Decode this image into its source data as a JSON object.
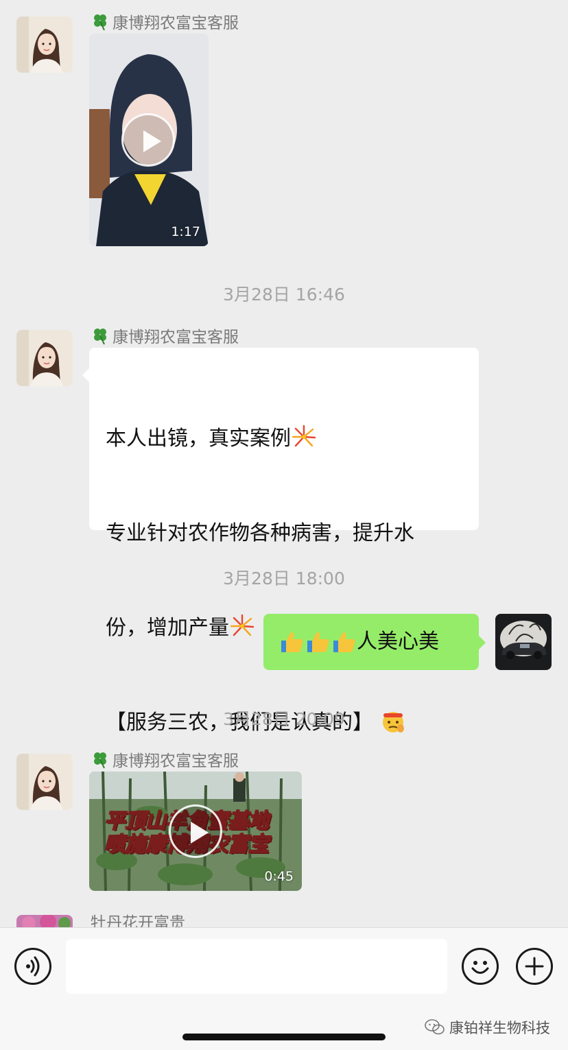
{
  "colors": {
    "background": "#ededed",
    "incoming_bubble": "#ffffff",
    "outgoing_bubble": "#95ec69",
    "timestamp": "#a4a4a4"
  },
  "messages": [
    {
      "sender": "康博翔农富宝客服",
      "type": "video",
      "duration": "1:17"
    },
    {
      "timestamp": "3月28日 16:46"
    },
    {
      "sender": "康博翔农富宝客服",
      "type": "text",
      "lines": [
        "本人出镜，真实案例",
        "专业针对农作物各种病害，提升水",
        "份，增加产量",
        "【服务三农，我们是认真的】"
      ]
    },
    {
      "timestamp": "3月28日 18:00"
    },
    {
      "type": "text",
      "outgoing": true,
      "text": "人美心美",
      "emoji": "thumbs-up-icon"
    },
    {
      "timestamp": "3月28日 20:09"
    },
    {
      "sender": "康博翔农富宝客服",
      "type": "video",
      "duration": "0:45",
      "overlay_line1": "平顶山羊角蜜基地",
      "overlay_line2": "喷施康博翔农富宝"
    },
    {
      "sender": "牡丹花开富贵"
    }
  ],
  "watermark": "康铂祥生物科技"
}
